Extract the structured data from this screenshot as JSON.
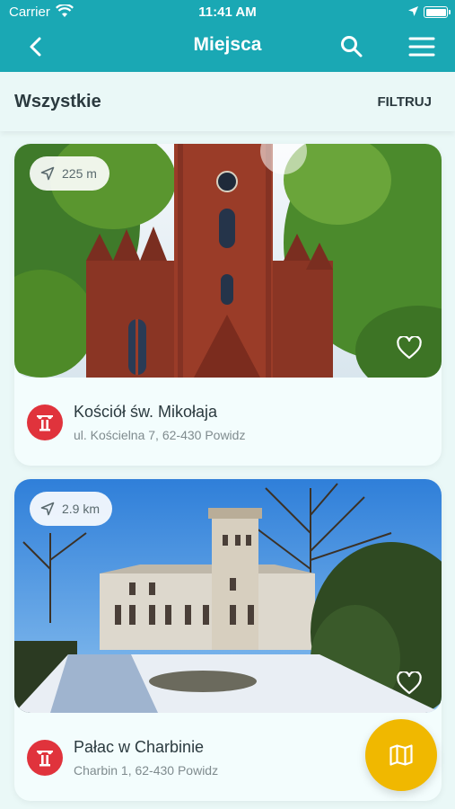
{
  "status": {
    "carrier": "Carrier",
    "time": "11:41 AM"
  },
  "nav": {
    "title": "Miejsca"
  },
  "subbar": {
    "section": "Wszystkie",
    "filter_label": "FILTRUJ"
  },
  "places": [
    {
      "distance": "225 m",
      "name": "Kościół św. Mikołaja",
      "address": "ul. Kościelna 7, 62-430 Powidz"
    },
    {
      "distance": "2.9 km",
      "name": "Pałac w Charbinie",
      "address": "Charbin 1, 62-430 Powidz"
    }
  ],
  "colors": {
    "header": "#1aa8b4",
    "badge": "#e0333c",
    "fab": "#f0b800",
    "background": "#eaf8f7"
  }
}
